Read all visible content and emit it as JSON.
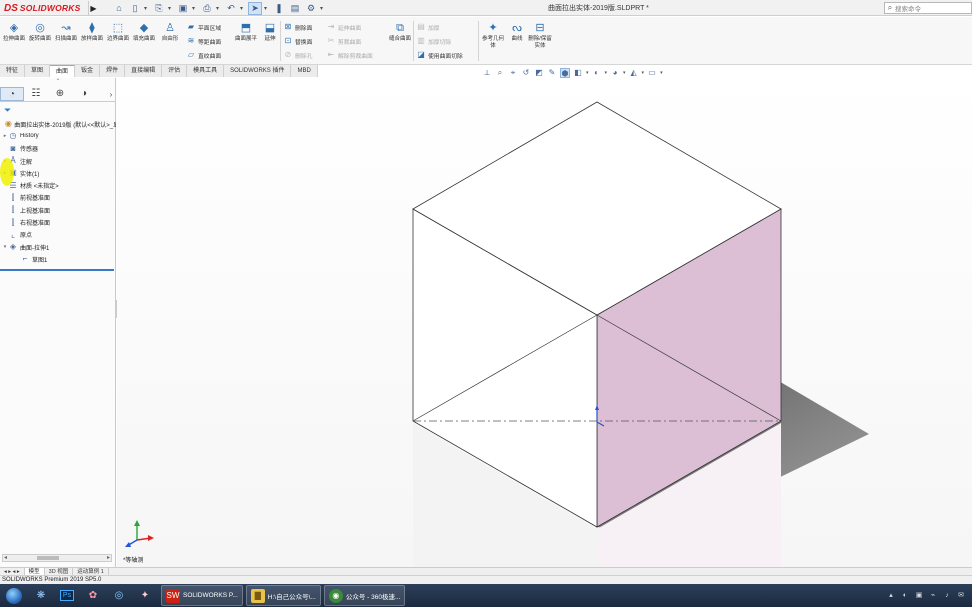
{
  "titlebar": {
    "logo_ds": "DS",
    "logo_text": "SOLIDWORKS",
    "document_title": "曲面拉出实体-2019版.SLDPRT *",
    "search_placeholder": "搜索命令"
  },
  "ribbon": {
    "big_buttons": [
      {
        "label": "拉伸曲面",
        "icon": "extruded-surface-icon"
      },
      {
        "label": "旋转曲面",
        "icon": "revolved-surface-icon"
      },
      {
        "label": "扫描曲面",
        "icon": "swept-surface-icon"
      },
      {
        "label": "放样曲面",
        "icon": "lofted-surface-icon"
      },
      {
        "label": "边界曲面",
        "icon": "boundary-surface-icon"
      },
      {
        "label": "填充曲面",
        "icon": "filled-surface-icon"
      },
      {
        "label": "自由形",
        "icon": "freeform-icon"
      }
    ],
    "group1": [
      "平面区域",
      "等距曲面",
      "直纹曲面"
    ],
    "btn_surface_flatten": "曲面展平",
    "btn_extend": "延伸",
    "group2": [
      "删除面",
      "替换面",
      "删除孔"
    ],
    "group3_dim": [
      "延伸曲面",
      "剪裁曲面",
      "解除剪裁曲面"
    ],
    "btn_knit": "缝合曲面",
    "group4_dim": [
      "加厚",
      "加厚切除"
    ],
    "group4_active": "使用曲面切除",
    "btn_ref_geom": "参考几何体",
    "btn_curves": "曲线",
    "btn_delete_body": "删除/保留实体"
  },
  "tabs": [
    "特征",
    "草图",
    "曲面",
    "钣金",
    "焊件",
    "直接编辑",
    "评估",
    "模具工具",
    "SOLIDWORKS 插件",
    "MBD"
  ],
  "active_tab": "曲面",
  "tree": {
    "root": "曲面拉出实体-2019版 (默认<<默认>_显示状态 1>)",
    "items": [
      {
        "label": "History",
        "icon": "history-icon",
        "expand": "▸"
      },
      {
        "label": "传感器",
        "icon": "sensor-icon",
        "expand": ""
      },
      {
        "label": "注解",
        "icon": "annotation-icon",
        "expand": "▸"
      },
      {
        "label": "实体(1)",
        "icon": "solid-body-icon",
        "expand": "▸"
      },
      {
        "label": "材质 <未指定>",
        "icon": "material-icon",
        "expand": ""
      },
      {
        "label": "前视基准面",
        "icon": "plane-icon",
        "expand": ""
      },
      {
        "label": "上视基准面",
        "icon": "plane-icon",
        "expand": ""
      },
      {
        "label": "右视基准面",
        "icon": "plane-icon",
        "expand": ""
      },
      {
        "label": "原点",
        "icon": "origin-icon",
        "expand": ""
      },
      {
        "label": "曲面-拉伸1",
        "icon": "surface-extrude-icon",
        "expand": "▾"
      },
      {
        "label": "草图1",
        "icon": "sketch-icon",
        "expand": ""
      }
    ]
  },
  "viewport": {
    "view_label": "*等轴测",
    "cube_face_color": "#dcbfd4"
  },
  "bottom_tabs": [
    "模型",
    "3D 视图",
    "运动算例 1"
  ],
  "status": "SOLIDWORKS Premium 2019 SP5.0",
  "taskbar": {
    "apps": [
      {
        "label": "SOLIDWORKS P...",
        "icon": "solidworks-icon"
      },
      {
        "label": "H:\\自己公众号\\...",
        "icon": "folder-icon"
      },
      {
        "label": "公众号 - 360极速...",
        "icon": "browser-icon"
      }
    ]
  }
}
